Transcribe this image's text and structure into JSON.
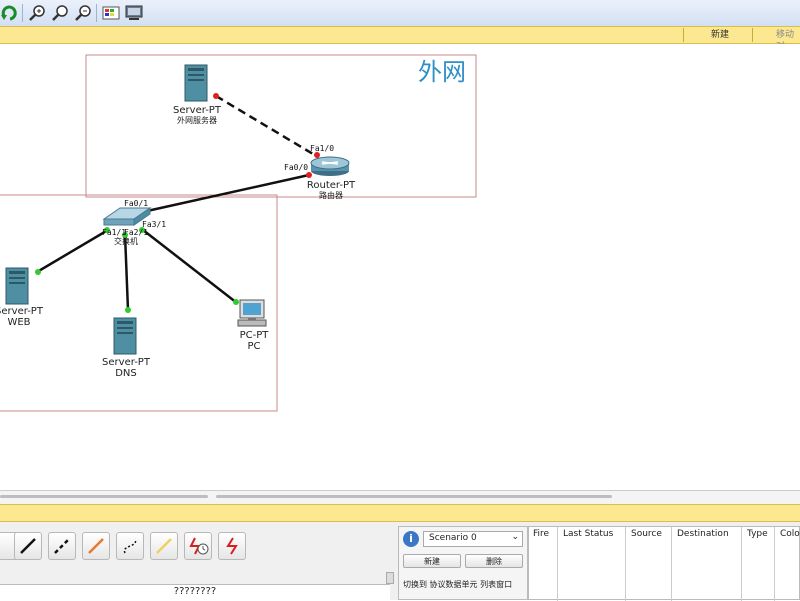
{
  "toolbar": {
    "icons": [
      "refresh-icon",
      "zoom-in-icon",
      "zoom-reset-icon",
      "zoom-out-icon",
      "palette-icon",
      "viewport-icon"
    ]
  },
  "top_bar": {
    "new_label": "新建",
    "move_label": "移动对"
  },
  "canvas": {
    "cluster_outer_label": "外网",
    "devices": {
      "outer_server": {
        "model": "Server-PT",
        "name": "外网服务器"
      },
      "router": {
        "model": "Router-PT",
        "name": "路由器"
      },
      "switch": {
        "name": "交换机"
      },
      "web_server": {
        "model": "Server-PT",
        "name": "WEB"
      },
      "dns_server": {
        "model": "Server-PT",
        "name": "DNS"
      },
      "pc": {
        "model": "PC-PT",
        "name": "PC"
      }
    },
    "ports": {
      "router_fa1_0": "Fa1/0",
      "router_fa0_0": "Fa0/0",
      "switch_fa0_1": "Fa0/1",
      "switch_fa3_1": "Fa3/1",
      "switch_fa1_1": "Fa1/1",
      "switch_fa2_1": "Fa2/1"
    }
  },
  "bottom": {
    "status_text": "????????",
    "scenario": {
      "selected": "Scenario 0",
      "new_label": "新建",
      "delete_label": "删除",
      "toggle_label": "切换到 协议数据单元 列表窗口"
    },
    "event_table": {
      "columns": [
        "Fire",
        "Last Status",
        "Source",
        "Destination",
        "Type",
        "Colo"
      ]
    }
  }
}
